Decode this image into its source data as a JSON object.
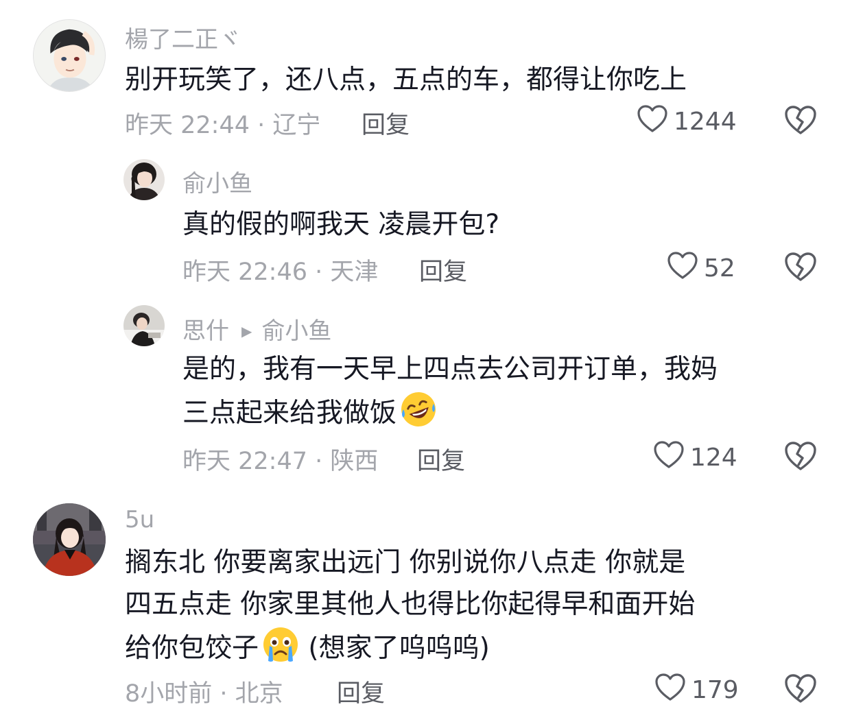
{
  "comments": [
    {
      "username": "楊了二正ヾ",
      "text": "别开玩笑了，还八点，五点的车，都得让你吃上",
      "meta": "昨天 22:44 · 辽宁",
      "reply_label": "回复",
      "likes": "1244"
    },
    {
      "username": "俞小鱼",
      "text": "真的假的啊我天 凌晨开包?",
      "meta": "昨天 22:46 · 天津",
      "reply_label": "回复",
      "likes": "52"
    },
    {
      "username": "思什",
      "reply_to": "俞小鱼",
      "text_line1": "是的，我有一天早上四点去公司开订单，我妈",
      "text_line2": "三点起来给我做饭",
      "emoji": "rofl-emoji",
      "meta": "昨天 22:47 · 陕西",
      "reply_label": "回复",
      "likes": "124"
    },
    {
      "username": "5u",
      "text_line1": "搁东北 你要离家出远门 你别说你八点走 你就是",
      "text_line2": "四五点走 你家里其他人也得比你起得早和面开始",
      "text_line3_a": "给你包饺子",
      "emoji": "crying-emoji",
      "text_line3_b": " (想家了呜呜呜)",
      "meta": "8小时前 · 北京",
      "reply_label": "回复",
      "likes": "179"
    }
  ],
  "icons": {
    "like": "heart-outline-icon",
    "dislike": "broken-heart-icon"
  },
  "colors": {
    "text": "#161823",
    "secondary": "#a3a5ab",
    "action": "#5a5c63"
  }
}
